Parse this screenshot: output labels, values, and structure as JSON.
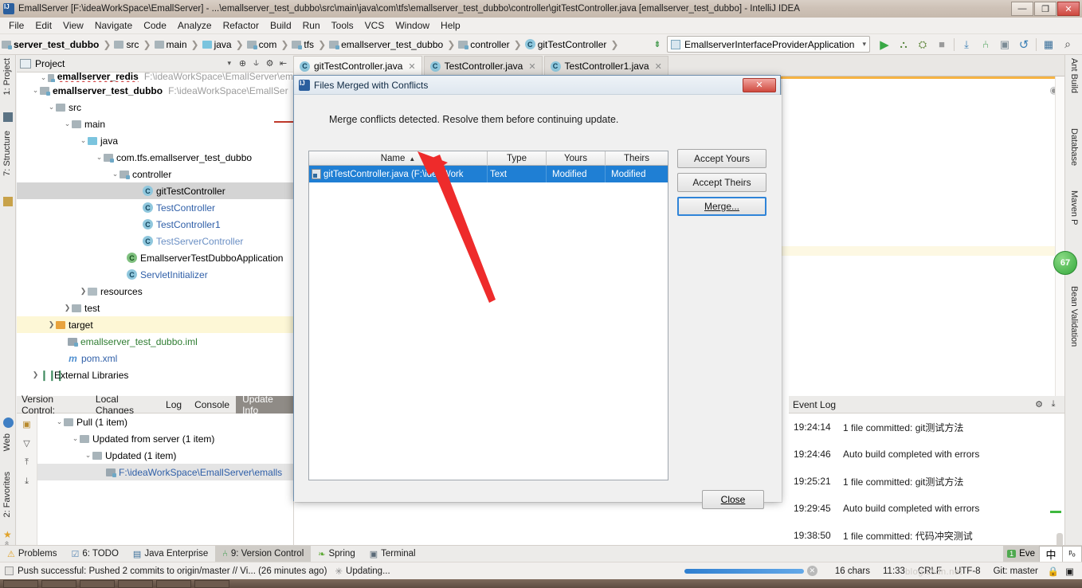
{
  "window": {
    "title": "EmallServer [F:\\ideaWorkSpace\\EmallServer] - ...\\emallserver_test_dubbo\\src\\main\\java\\com\\tfs\\emallserver_test_dubbo\\controller\\gitTestController.java [emallserver_test_dubbo] - IntelliJ IDEA",
    "minimize": "—",
    "maximize": "❐",
    "close": "✕"
  },
  "menubar": {
    "items": [
      "File",
      "Edit",
      "View",
      "Navigate",
      "Code",
      "Analyze",
      "Refactor",
      "Build",
      "Run",
      "Tools",
      "VCS",
      "Window",
      "Help"
    ]
  },
  "breadcrumb": {
    "items": [
      {
        "label": "server_test_dubbo",
        "icon": "module-icon",
        "bold": true
      },
      {
        "label": "src",
        "icon": "folder-icon"
      },
      {
        "label": "main",
        "icon": "folder-icon"
      },
      {
        "label": "java",
        "icon": "source-folder-icon"
      },
      {
        "label": "com",
        "icon": "package-icon"
      },
      {
        "label": "tfs",
        "icon": "package-icon"
      },
      {
        "label": "emallserver_test_dubbo",
        "icon": "package-icon"
      },
      {
        "label": "controller",
        "icon": "package-icon"
      },
      {
        "label": "gitTestController",
        "icon": "class-icon"
      }
    ],
    "separator": "❯"
  },
  "run_toolbar": {
    "config_name": "EmallserverInterfaceProviderApplication",
    "caret": "▾",
    "buttons": [
      "run-icon",
      "debug-icon",
      "coverage-icon",
      "stop-icon",
      "update-icon",
      "vcs-icon",
      "screenshot-icon",
      "revert-icon",
      "layout-icon",
      "search-icon"
    ],
    "sort_icon": "sort-numeric-icon"
  },
  "left_strip": {
    "items": [
      {
        "label": "1: Project",
        "selected": true
      },
      {
        "label": "7: Structure",
        "selected": false
      },
      {
        "label": "Web",
        "selected": false
      },
      {
        "label": "2: Favorites",
        "selected": false
      }
    ]
  },
  "right_strip": {
    "items": [
      "Ant Build",
      "Database",
      "Maven P",
      "Bean Validation"
    ]
  },
  "project_panel": {
    "header_title": "Project",
    "header_caret": "▾",
    "buttons": [
      "collapse-target-icon",
      "expand-collapse-icon",
      "settings-icon",
      "hide-icon"
    ],
    "tree": [
      {
        "indent": 1,
        "twisty": "⌄",
        "label": "emallserver_redis",
        "path": "F:\\ideaWorkSpace\\EmallServer\\em",
        "icon": "module-icon",
        "bold": true,
        "cut": true
      },
      {
        "indent": 1,
        "twisty": "⌄",
        "label": "emallserver_test_dubbo",
        "path": "F:\\ideaWorkSpace\\EmallSer",
        "icon": "module-icon",
        "bold": true
      },
      {
        "indent": 2,
        "twisty": "⌄",
        "label": "src",
        "icon": "folder-icon"
      },
      {
        "indent": 3,
        "twisty": "⌄",
        "label": "main",
        "icon": "folder-icon"
      },
      {
        "indent": 4,
        "twisty": "⌄",
        "label": "java",
        "icon": "source-folder-icon"
      },
      {
        "indent": 5,
        "twisty": "⌄",
        "label": "com.tfs.emallserver_test_dubbo",
        "icon": "package-icon"
      },
      {
        "indent": 6,
        "twisty": "⌄",
        "label": "controller",
        "icon": "package-icon"
      },
      {
        "indent": 7,
        "twisty": "",
        "label": "gitTestController",
        "icon": "class-icon",
        "selected": true
      },
      {
        "indent": 7,
        "twisty": "",
        "label": "TestController",
        "icon": "class-icon",
        "color": "blue"
      },
      {
        "indent": 7,
        "twisty": "",
        "label": "TestController1",
        "icon": "class-icon",
        "color": "blue"
      },
      {
        "indent": 7,
        "twisty": "",
        "label": "TestServerController",
        "icon": "class-icon",
        "color": "lblue"
      },
      {
        "indent": 6,
        "twisty": "",
        "label": "EmallserverTestDubboApplication",
        "icon": "class-run-icon"
      },
      {
        "indent": 6,
        "twisty": "",
        "label": "ServletInitializer",
        "icon": "class-icon",
        "color": "blue"
      },
      {
        "indent": 4,
        "twisty": "❯",
        "label": "resources",
        "icon": "resource-folder-icon"
      },
      {
        "indent": 3,
        "twisty": "❯",
        "label": "test",
        "icon": "folder-icon"
      },
      {
        "indent": 2,
        "twisty": "❯",
        "label": "target",
        "icon": "excluded-folder-icon",
        "highlight": true
      },
      {
        "indent": 3,
        "twisty": "",
        "label": "emallserver_test_dubbo.iml",
        "icon": "iml-file-icon",
        "color": "green"
      },
      {
        "indent": 3,
        "twisty": "",
        "label": "pom.xml",
        "icon": "maven-file-icon",
        "color": "blue"
      },
      {
        "indent": 1,
        "twisty": "❯",
        "label": "External Libraries",
        "icon": "libraries-icon"
      }
    ]
  },
  "editor_tabs": [
    {
      "label": "gitTestController.java",
      "icon": "class-icon",
      "active": true,
      "close": "✕"
    },
    {
      "label": "TestController.java",
      "icon": "class-icon",
      "active": false,
      "close": "✕"
    },
    {
      "label": "TestController1.java",
      "icon": "class-icon",
      "active": false,
      "close": "✕"
    }
  ],
  "editor": {
    "eye_icon": "preview-eye-icon",
    "inspection_badge": "67"
  },
  "dialog": {
    "title": "Files Merged with Conflicts",
    "title_icon": "intellij-icon",
    "close_label": "✕",
    "message": "Merge conflicts detected. Resolve them before continuing update.",
    "table": {
      "columns": [
        "Name",
        "Type",
        "Yours",
        "Theirs"
      ],
      "sort_column": "Name",
      "sort_arrow": "▲",
      "rows": [
        {
          "icon": "merge-conflict-file-icon",
          "name": "gitTestController.java (F:\\ideaWork",
          "type": "Text",
          "yours": "Modified",
          "theirs": "Modified",
          "selected": true
        }
      ]
    },
    "buttons": [
      {
        "label": "Accept Yours",
        "mnemonic": "Y",
        "focused": false
      },
      {
        "label": "Accept Theirs",
        "mnemonic": "T",
        "focused": false
      },
      {
        "label": "Merge...",
        "mnemonic": "M",
        "focused": true
      }
    ],
    "close_button": {
      "label": "Close",
      "mnemonic": "C"
    }
  },
  "version_control_panel": {
    "label": "Version Control:",
    "tabs": [
      {
        "label": "Local Changes",
        "active": false
      },
      {
        "label": "Log",
        "active": false
      },
      {
        "label": "Console",
        "active": false
      },
      {
        "label": "Update Info",
        "active": true
      }
    ],
    "side_buttons": [
      "group-by-icon",
      "filter-icon",
      "expand-all-icon",
      "collapse-all-icon"
    ],
    "tree": [
      {
        "indent": 1,
        "twisty": "⌄",
        "label": "Pull (1 item)",
        "icon": "folder-icon"
      },
      {
        "indent": 2,
        "twisty": "⌄",
        "label": "Updated from server (1 item)",
        "icon": "folder-icon"
      },
      {
        "indent": 3,
        "twisty": "⌄",
        "label": "Updated (1 item)",
        "icon": "folder-icon"
      },
      {
        "indent": 4,
        "twisty": "",
        "label": "F:\\ideaWorkSpace\\EmallServer\\emalls",
        "icon": "file-icon",
        "color": "blue",
        "selected": true
      }
    ]
  },
  "event_log": {
    "title": "Event Log",
    "buttons": [
      "settings-gear-icon",
      "hide-icon"
    ],
    "entries": [
      {
        "time": "19:24:14",
        "message": "1 file committed: git测试方法"
      },
      {
        "time": "19:24:46",
        "message": "Auto build completed with errors"
      },
      {
        "time": "19:25:21",
        "message": "1 file committed: git测试方法"
      },
      {
        "time": "19:29:45",
        "message": "Auto build completed with errors"
      },
      {
        "time": "19:38:50",
        "message": "1 file committed: 代码冲突测试"
      }
    ]
  },
  "tool_tabs": {
    "items": [
      {
        "label": "Problems",
        "icon": "warning-icon",
        "active": false
      },
      {
        "label": "6: TODO",
        "icon": "todo-icon",
        "active": false
      },
      {
        "label": "Java Enterprise",
        "icon": "java-enterprise-icon",
        "active": false
      },
      {
        "label": "9: Version Control",
        "icon": "vcs-branch-icon",
        "active": true
      },
      {
        "label": "Spring",
        "icon": "spring-leaf-icon",
        "active": false
      },
      {
        "label": "Terminal",
        "icon": "terminal-icon",
        "active": false
      }
    ],
    "event_badge": {
      "count": "1",
      "label": "Eve"
    },
    "ime": {
      "primary": "中",
      "secondary": "ᵖₒ"
    }
  },
  "status_bar": {
    "message": "Push successful: Pushed 2 commits to origin/master // Vi... (26 minutes ago)",
    "activity": "Updating...",
    "progress_percent": 100,
    "cancel_icon": "cancel-icon",
    "cells": [
      "16 chars",
      "11:33",
      "CRLF",
      "UTF-8",
      "Git: master"
    ],
    "lock_icon": "lock-icon",
    "inspection_icon": "inspection-icon",
    "watermark": "blog.csdn.net"
  }
}
